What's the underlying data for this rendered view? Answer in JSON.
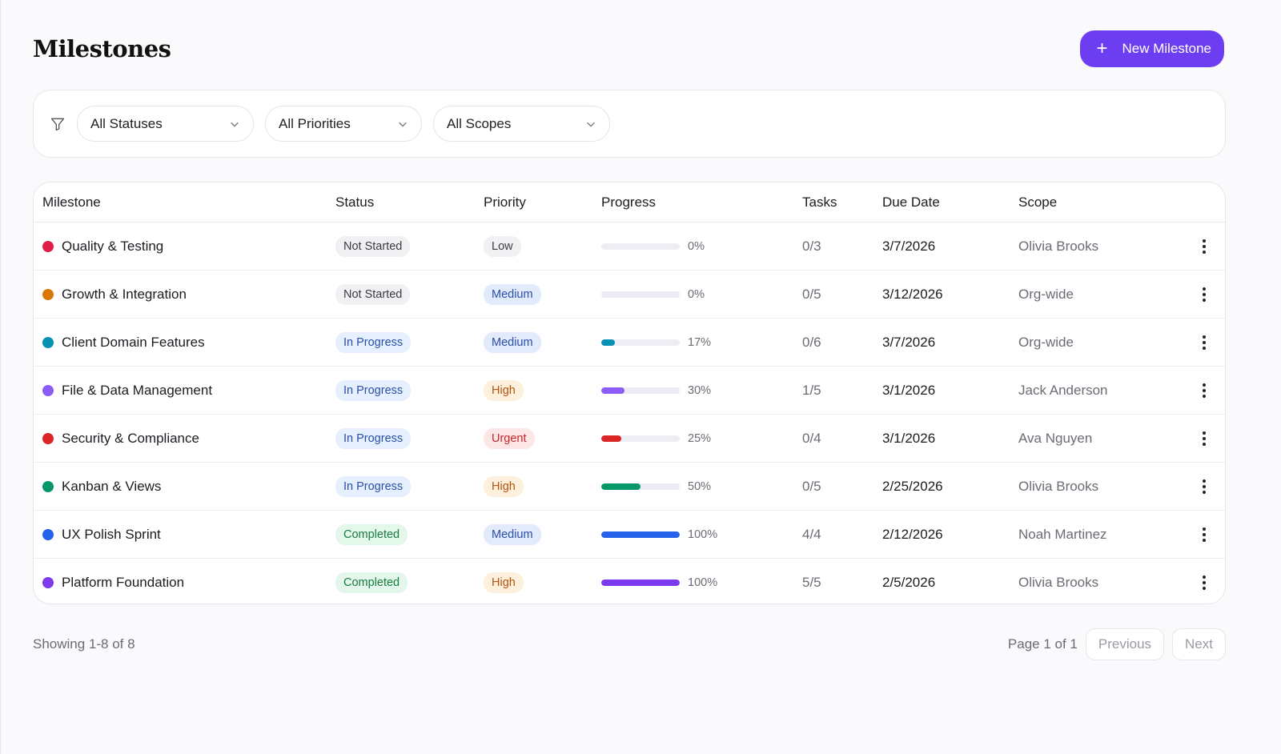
{
  "header": {
    "title": "Milestones",
    "new_button_label": "New Milestone"
  },
  "filters": {
    "status": "All Statuses",
    "priority": "All Priorities",
    "scope": "All Scopes"
  },
  "table": {
    "columns": {
      "milestone": "Milestone",
      "status": "Status",
      "priority": "Priority",
      "progress": "Progress",
      "tasks": "Tasks",
      "due": "Due Date",
      "scope": "Scope"
    },
    "rows": [
      {
        "name": "Quality & Testing",
        "dot_color": "#e11d48",
        "status": "Not Started",
        "priority": "Low",
        "progress": 0,
        "progress_label": "0%",
        "progress_color": "#ededf3",
        "tasks": "0/3",
        "due": "3/7/2026",
        "scope": "Olivia Brooks"
      },
      {
        "name": "Growth & Integration",
        "dot_color": "#d97706",
        "status": "Not Started",
        "priority": "Medium",
        "progress": 0,
        "progress_label": "0%",
        "progress_color": "#ededf3",
        "tasks": "0/5",
        "due": "3/12/2026",
        "scope": "Org-wide"
      },
      {
        "name": "Client Domain Features",
        "dot_color": "#0891b2",
        "status": "In Progress",
        "priority": "Medium",
        "progress": 17,
        "progress_label": "17%",
        "progress_color": "#0891b2",
        "tasks": "0/6",
        "due": "3/7/2026",
        "scope": "Org-wide"
      },
      {
        "name": "File & Data Management",
        "dot_color": "#8b5cf6",
        "status": "In Progress",
        "priority": "High",
        "progress": 30,
        "progress_label": "30%",
        "progress_color": "#8b5cf6",
        "tasks": "1/5",
        "due": "3/1/2026",
        "scope": "Jack Anderson"
      },
      {
        "name": "Security & Compliance",
        "dot_color": "#dc2626",
        "status": "In Progress",
        "priority": "Urgent",
        "progress": 25,
        "progress_label": "25%",
        "progress_color": "#dc2626",
        "tasks": "0/4",
        "due": "3/1/2026",
        "scope": "Ava Nguyen"
      },
      {
        "name": "Kanban & Views",
        "dot_color": "#059669",
        "status": "In Progress",
        "priority": "High",
        "progress": 50,
        "progress_label": "50%",
        "progress_color": "#059669",
        "tasks": "0/5",
        "due": "2/25/2026",
        "scope": "Olivia Brooks"
      },
      {
        "name": "UX Polish Sprint",
        "dot_color": "#2563eb",
        "status": "Completed",
        "priority": "Medium",
        "progress": 100,
        "progress_label": "100%",
        "progress_color": "#2563eb",
        "tasks": "4/4",
        "due": "2/12/2026",
        "scope": "Noah Martinez"
      },
      {
        "name": "Platform Foundation",
        "dot_color": "#7c3aed",
        "status": "Completed",
        "priority": "High",
        "progress": 100,
        "progress_label": "100%",
        "progress_color": "#7c3aed",
        "tasks": "5/5",
        "due": "2/5/2026",
        "scope": "Olivia Brooks"
      }
    ]
  },
  "status_styles": {
    "Not Started": {
      "bg": "#f1f1f4",
      "fg": "#3a3a44"
    },
    "In Progress": {
      "bg": "#e6effd",
      "fg": "#2b4fa8"
    },
    "Completed": {
      "bg": "#e3f7ea",
      "fg": "#1b7a43"
    }
  },
  "priority_styles": {
    "Low": {
      "bg": "#f1f1f4",
      "fg": "#3a3a44"
    },
    "Medium": {
      "bg": "#e2ebfb",
      "fg": "#2b4fa8"
    },
    "High": {
      "bg": "#fdf0dc",
      "fg": "#b4540e"
    },
    "Urgent": {
      "bg": "#fde6e6",
      "fg": "#c42626"
    }
  },
  "footer": {
    "showing": "Showing 1-8 of 8",
    "page_info": "Page 1 of 1",
    "previous_label": "Previous",
    "next_label": "Next"
  }
}
